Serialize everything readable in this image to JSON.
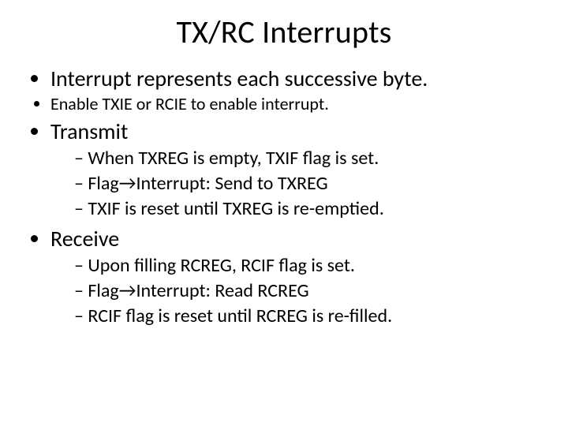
{
  "title": "TX/RC Interrupts",
  "bullets": {
    "b1": "Interrupt represents each successive byte.",
    "b2": "Enable TXIE or RCIE to enable interrupt.",
    "b3": "Transmit",
    "b3_sub": {
      "s1": "When TXREG is empty, TXIF flag is set.",
      "s2": "Flag→Interrupt: Send to TXREG",
      "s3": "TXIF is reset until TXREG is re-emptied."
    },
    "b4": "Receive",
    "b4_sub": {
      "s1": "Upon filling RCREG, RCIF flag is set.",
      "s2": "Flag→Interrupt: Read RCREG",
      "s3": "RCIF flag is reset until RCREG is re-filled."
    }
  }
}
